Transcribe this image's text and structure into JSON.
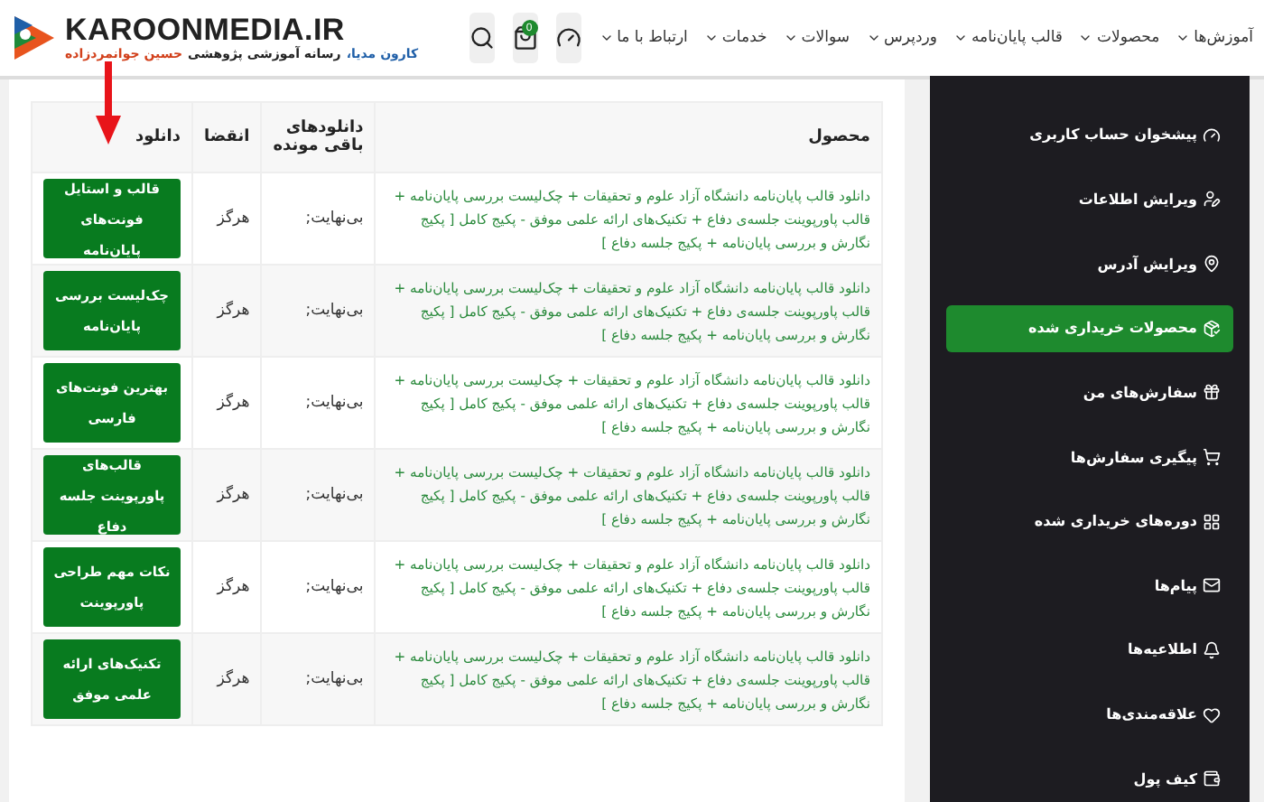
{
  "header": {
    "logo": {
      "title": "KAROONMEDIA.IR",
      "tagline": [
        {
          "text": "کارون مدیا،",
          "color": "#1f5fa8"
        },
        {
          "text": "رسانه آموزشی پژوهشی",
          "color": "#222222"
        },
        {
          "text": "حسین جوانمردزاده",
          "color": "#d2401b"
        }
      ]
    },
    "cart_count": "0",
    "nav": [
      "آموزش‌ها",
      "محصولات",
      "قالب پایان‌نامه",
      "وردپرس",
      "سوالات",
      "خدمات",
      "ارتباط با ما"
    ]
  },
  "table": {
    "columns": [
      "محصول",
      "دانلودهای باقی مونده",
      "انقضا",
      "دانلود"
    ],
    "rows": [
      {
        "product": "دانلود قالب پایان‌نامه دانشگاه آزاد علوم و تحقیقات + چک‌لیست بررسی پایان‌نامه + قالب پاورپوینت جلسه‌ی دفاع + تکنیک‌های ارائه علمی موفق - پکیج کامل [ پکیج نگارش و بررسی پایان‌نامه + پکیج جلسه دفاع ]",
        "remaining": "بی‌نهایت;",
        "expires": "هرگز",
        "download": "قالب و استایل فونت‌های پایان‌نامه"
      },
      {
        "product": "دانلود قالب پایان‌نامه دانشگاه آزاد علوم و تحقیقات + چک‌لیست بررسی پایان‌نامه + قالب پاورپوینت جلسه‌ی دفاع + تکنیک‌های ارائه علمی موفق - پکیج کامل [ پکیج نگارش و بررسی پایان‌نامه + پکیج جلسه دفاع ]",
        "remaining": "بی‌نهایت;",
        "expires": "هرگز",
        "download": "چک‌لیست بررسی پایان‌نامه"
      },
      {
        "product": "دانلود قالب پایان‌نامه دانشگاه آزاد علوم و تحقیقات + چک‌لیست بررسی پایان‌نامه + قالب پاورپوینت جلسه‌ی دفاع + تکنیک‌های ارائه علمی موفق - پکیج کامل [ پکیج نگارش و بررسی پایان‌نامه + پکیج جلسه دفاع ]",
        "remaining": "بی‌نهایت;",
        "expires": "هرگز",
        "download": "بهترین فونت‌های فارسی"
      },
      {
        "product": "دانلود قالب پایان‌نامه دانشگاه آزاد علوم و تحقیقات + چک‌لیست بررسی پایان‌نامه + قالب پاورپوینت جلسه‌ی دفاع + تکنیک‌های ارائه علمی موفق - پکیج کامل [ پکیج نگارش و بررسی پایان‌نامه + پکیج جلسه دفاع ]",
        "remaining": "بی‌نهایت;",
        "expires": "هرگز",
        "download": "قالب‌های پاورپوینت جلسه دفاع"
      },
      {
        "product": "دانلود قالب پایان‌نامه دانشگاه آزاد علوم و تحقیقات + چک‌لیست بررسی پایان‌نامه + قالب پاورپوینت جلسه‌ی دفاع + تکنیک‌های ارائه علمی موفق - پکیج کامل [ پکیج نگارش و بررسی پایان‌نامه + پکیج جلسه دفاع ]",
        "remaining": "بی‌نهایت;",
        "expires": "هرگز",
        "download": "نکات مهم طراحی پاورپوینت"
      },
      {
        "product": "دانلود قالب پایان‌نامه دانشگاه آزاد علوم و تحقیقات + چک‌لیست بررسی پایان‌نامه + قالب پاورپوینت جلسه‌ی دفاع + تکنیک‌های ارائه علمی موفق - پکیج کامل [ پکیج نگارش و بررسی پایان‌نامه + پکیج جلسه دفاع ]",
        "remaining": "بی‌نهایت;",
        "expires": "هرگز",
        "download": "تکنیک‌های ارائه علمی موفق"
      }
    ]
  },
  "sidebar": {
    "items": [
      {
        "label": "پیشخوان حساب کاربری",
        "selected": false
      },
      {
        "label": "ویرایش اطلاعات",
        "selected": false
      },
      {
        "label": "ویرایش آدرس",
        "selected": false
      },
      {
        "label": "محصولات خریداری شده",
        "selected": true
      },
      {
        "label": "سفارش‌های من",
        "selected": false
      },
      {
        "label": "پیگیری سفارش‌ها",
        "selected": false
      },
      {
        "label": "دوره‌های خریداری شده",
        "selected": false
      },
      {
        "label": "پیام‌ها",
        "selected": false
      },
      {
        "label": "اطلاعیه‌ها",
        "selected": false
      },
      {
        "label": "علاقه‌مندی‌ها",
        "selected": false
      },
      {
        "label": "کیف پول",
        "selected": false
      }
    ]
  }
}
